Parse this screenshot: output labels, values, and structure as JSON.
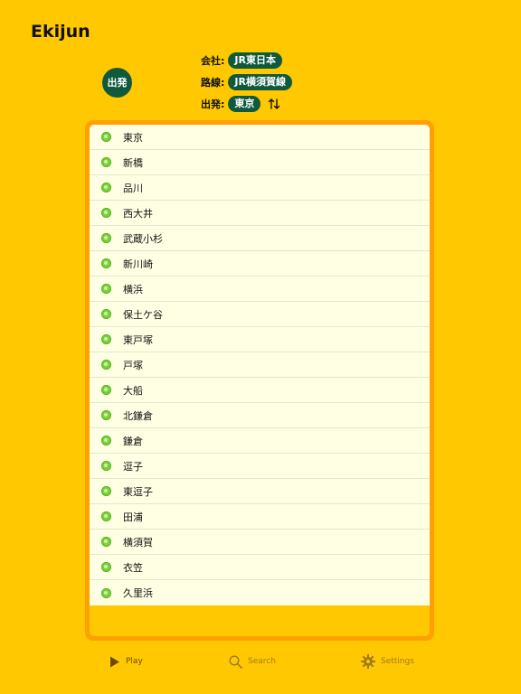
{
  "app": {
    "title": "Ekijun"
  },
  "depart_button": {
    "label": "出発"
  },
  "info": {
    "company": {
      "label": "会社:",
      "value": "JR東日本"
    },
    "line": {
      "label": "路線:",
      "value": "JR横須賀線"
    },
    "origin": {
      "label": "出発:",
      "value": "東京"
    }
  },
  "stations": [
    "東京",
    "新橋",
    "品川",
    "西大井",
    "武蔵小杉",
    "新川崎",
    "横浜",
    "保土ケ谷",
    "東戸塚",
    "戸塚",
    "大船",
    "北鎌倉",
    "鎌倉",
    "逗子",
    "東逗子",
    "田浦",
    "横須賀",
    "衣笠",
    "久里浜"
  ],
  "tabbar": {
    "tabs": [
      {
        "label": "Play",
        "icon": "play-icon",
        "active": true
      },
      {
        "label": "Search",
        "icon": "search-icon",
        "active": false
      },
      {
        "label": "Settings",
        "icon": "gear-icon",
        "active": false
      }
    ]
  },
  "colors": {
    "background": "#FFC800",
    "frame": "#FFA000",
    "list_bg": "#FFFFE4",
    "pill": "#0F5A3C",
    "dot": "#7AD23A"
  }
}
